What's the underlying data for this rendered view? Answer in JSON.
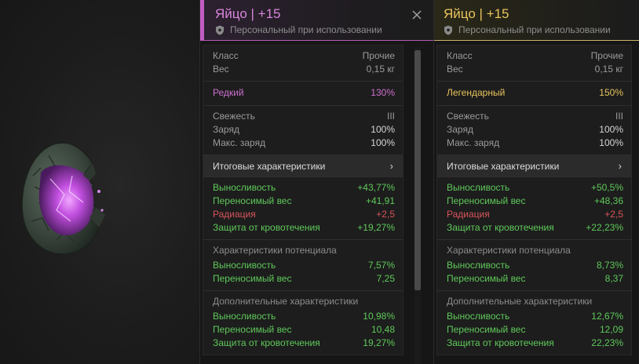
{
  "colors": {
    "rare": "#c25bc4",
    "legendary": "#e8c45c",
    "positive": "#5fc95a",
    "negative": "#d9545a"
  },
  "left_item": {
    "title": "Яйцо | +15",
    "binding": "Персональный при использовании",
    "basic": [
      {
        "label": "Класс",
        "value": "Прочие"
      },
      {
        "label": "Вес",
        "value": "0,15 кг"
      }
    ],
    "rarity": {
      "label": "Редкий",
      "value": "130%"
    },
    "props": [
      {
        "label": "Свежесть",
        "value": "III"
      },
      {
        "label": "Заряд",
        "value": "100%"
      },
      {
        "label": "Макс. заряд",
        "value": "100%"
      }
    ],
    "summary_label": "Итоговые характеристики",
    "final": [
      {
        "label": "Выносливость",
        "value": "+43,77%"
      },
      {
        "label": "Переносимый вес",
        "value": "+41,91"
      },
      {
        "label": "Радиация",
        "value": "+2,5"
      },
      {
        "label": "Защита от кровотечения",
        "value": "+19,27%"
      }
    ],
    "potential_title": "Характеристики потенциала",
    "potential": [
      {
        "label": "Выносливость",
        "value": "7,57%"
      },
      {
        "label": "Переносимый вес",
        "value": "7,25"
      }
    ],
    "extra_title": "Дополнительные характеристики",
    "extra": [
      {
        "label": "Выносливость",
        "value": "10,98%"
      },
      {
        "label": "Переносимый вес",
        "value": "10,48"
      },
      {
        "label": "Защита от кровотечения",
        "value": "19,27%"
      }
    ]
  },
  "right_item": {
    "title": "Яйцо | +15",
    "binding": "Персональный при использовании",
    "basic": [
      {
        "label": "Класс",
        "value": "Прочие"
      },
      {
        "label": "Вес",
        "value": "0,15 кг"
      }
    ],
    "rarity": {
      "label": "Легендарный",
      "value": "150%"
    },
    "props": [
      {
        "label": "Свежесть",
        "value": "III"
      },
      {
        "label": "Заряд",
        "value": "100%"
      },
      {
        "label": "Макс. заряд",
        "value": "100%"
      }
    ],
    "summary_label": "Итоговые характеристики",
    "final": [
      {
        "label": "Выносливость",
        "value": "+50,5%"
      },
      {
        "label": "Переносимый вес",
        "value": "+48,36"
      },
      {
        "label": "Радиация",
        "value": "+2,5"
      },
      {
        "label": "Защита от кровотечения",
        "value": "+22,23%"
      }
    ],
    "potential_title": "Характеристики потенциала",
    "potential": [
      {
        "label": "Выносливость",
        "value": "8,73%"
      },
      {
        "label": "Переносимый вес",
        "value": "8,37"
      }
    ],
    "extra_title": "Дополнительные характеристики",
    "extra": [
      {
        "label": "Выносливость",
        "value": "12,67%"
      },
      {
        "label": "Переносимый вес",
        "value": "12,09"
      },
      {
        "label": "Защита от кровотечения",
        "value": "22,23%"
      }
    ]
  },
  "icons": {
    "shield": "shield-icon",
    "close": "close-icon",
    "chevron": "chevron-right-icon"
  }
}
